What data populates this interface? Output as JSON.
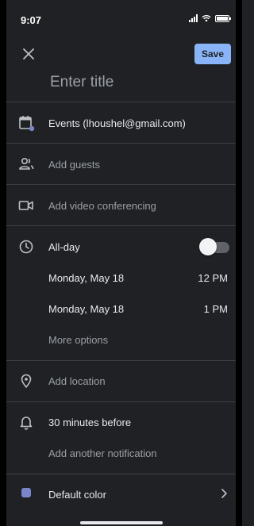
{
  "status_bar": {
    "time": "9:07"
  },
  "header": {
    "save_label": "Save"
  },
  "title": {
    "placeholder": "Enter title"
  },
  "calendar": {
    "account": "Events (lhoushel@gmail.com)"
  },
  "guests": {
    "label": "Add guests"
  },
  "video": {
    "label": "Add video conferencing"
  },
  "allday": {
    "label": "All-day",
    "enabled": false
  },
  "start": {
    "date": "Monday, May 18",
    "time": "12 PM"
  },
  "end": {
    "date": "Monday, May 18",
    "time": "1 PM"
  },
  "more_options": {
    "label": "More options"
  },
  "location": {
    "label": "Add location"
  },
  "notification": {
    "current": "30 minutes before",
    "add_label": "Add another notification"
  },
  "color": {
    "label": "Default color",
    "swatch": "#7986cb"
  },
  "colors": {
    "background": "#202124",
    "accent": "#8ab4f8"
  }
}
